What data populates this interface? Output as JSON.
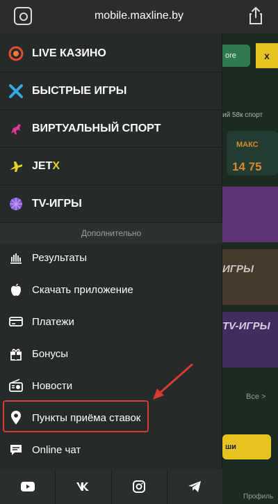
{
  "browser": {
    "url": "mobile.maxline.by"
  },
  "background": {
    "button_text": "ore",
    "close_symbol": "x",
    "line1": "ий 58к спорт",
    "banner_top": "МАКС",
    "banner_value": "14 75",
    "card2_text": "ИГРЫ",
    "card3_text": "TV-ИГРЫ",
    "more_link": "Все >",
    "yellow_btn": "ши",
    "profile": "Профиль"
  },
  "menu": {
    "main_items": [
      {
        "label": "LIVE КАЗИНО",
        "icon": "live-casino-icon",
        "color": "#e44b30"
      },
      {
        "label": "БЫСТРЫЕ ИГРЫ",
        "icon": "fast-games-icon",
        "color": "#33a9e0"
      },
      {
        "label": "ВИРТУАЛЬНЫЙ СПОРТ",
        "icon": "virtual-sport-icon",
        "color": "#e3368e"
      },
      {
        "label": "JET",
        "label_accent": "X",
        "icon": "jetx-icon",
        "color": "#e7d21f"
      },
      {
        "label": "TV-ИГРЫ",
        "icon": "tv-games-icon",
        "color": "#8a5bd6"
      }
    ],
    "section_header": "Дополнительно",
    "sub_items": [
      {
        "label": "Результаты",
        "icon": "results-icon"
      },
      {
        "label": "Скачать приложение",
        "icon": "apple-icon"
      },
      {
        "label": "Платежи",
        "icon": "payment-card-icon"
      },
      {
        "label": "Бонусы",
        "icon": "gift-icon"
      },
      {
        "label": "Новости",
        "icon": "radio-icon"
      },
      {
        "label": "Пункты приёма ставок",
        "icon": "location-pin-icon"
      },
      {
        "label": "Online чат",
        "icon": "chat-icon"
      }
    ],
    "social": [
      "youtube-icon",
      "vk-icon",
      "instagram-icon",
      "telegram-icon"
    ]
  },
  "annotation": {
    "highlight_color": "#d63c2f"
  }
}
